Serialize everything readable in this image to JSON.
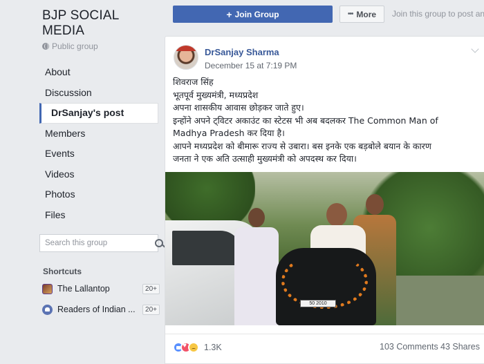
{
  "group": {
    "name_line1": "BJP SOCIAL",
    "name_line2": "MEDIA",
    "privacy": "Public group"
  },
  "nav": {
    "items": [
      {
        "label": "About"
      },
      {
        "label": "Discussion"
      },
      {
        "label": "DrSanjay's post"
      },
      {
        "label": "Members"
      },
      {
        "label": "Events"
      },
      {
        "label": "Videos"
      },
      {
        "label": "Photos"
      },
      {
        "label": "Files"
      }
    ],
    "active_index": 2
  },
  "search": {
    "placeholder": "Search this group",
    "value": ""
  },
  "shortcuts": {
    "title": "Shortcuts",
    "items": [
      {
        "label": "The Lallantop",
        "count": "20+"
      },
      {
        "label": "Readers of Indian ...",
        "count": "20+"
      }
    ]
  },
  "topbar": {
    "join_label": "Join Group",
    "more_label": "More",
    "hint": "Join this group to post and"
  },
  "post": {
    "author": "DrSanjay Sharma",
    "timestamp": "December 15 at 7:19 PM",
    "lines": [
      "शिवराज सिंह",
      "भूतपूर्व मुख्यमंत्री, मध्यप्रदेश",
      "अपना शासकीय आवास छोड़कर जाते हुए।",
      "इन्होंने अपने ट्विटर अकाउंट का स्टेटस भी अब बदलकर The Common Man of",
      "Madhya Pradesh कर दिया है।",
      "आपने मध्यप्रदेश को बीमारू राज्य से उबारा। बस इनके एक बड़बोले बयान के कारण",
      "जनता ने एक अति उत्साही मुख्यमंत्री को अपदस्थ कर दिया।"
    ],
    "photo_plate": "50 2010"
  },
  "reactions": {
    "icons": [
      "like-icon",
      "love-icon",
      "sad-icon"
    ],
    "count": "1.3K",
    "comments": "103 Comments",
    "shares": "43 Shares"
  },
  "colors": {
    "background": "#e9ebee",
    "brand_blue": "#4267b2",
    "link_blue": "#385898"
  }
}
